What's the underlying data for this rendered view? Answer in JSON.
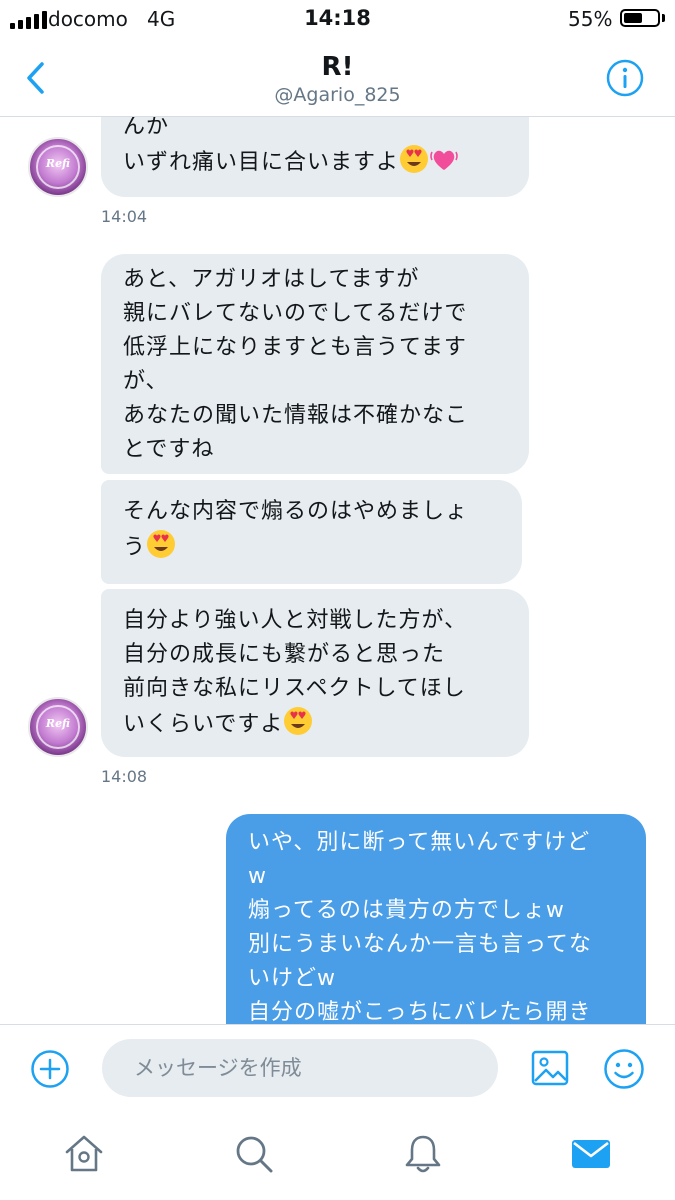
{
  "status_bar": {
    "carrier": "docomo",
    "network": "4G",
    "time": "14:18",
    "battery_percent": "55%",
    "battery_level": 0.55
  },
  "header": {
    "title": "R!",
    "handle": "@Agario_825",
    "back_icon": "chevron-left-icon",
    "info_icon": "info-icon"
  },
  "conversation": {
    "incoming_group_1": {
      "text": "んか\nいずれ痛い目に合いますよ",
      "emojis": [
        "heart-eyes-emoji",
        "growing-heart-emoji"
      ],
      "timestamp": "14:04"
    },
    "incoming_group_2": {
      "messages": [
        {
          "text": "あと、アガリオはしてますが\n親にバレてないのでしてるだけで\n低浮上になりますとも言うてます\nが、\nあなたの聞いた情報は不確かなこ\nとですね"
        },
        {
          "text": "そんな内容で煽るのはやめましょ\nう",
          "emoji": "heart-eyes-emoji"
        },
        {
          "text": "自分より強い人と対戦した方が、\n自分の成長にも繋がると思った\n前向きな私にリスペクトしてほし\nいくらいですよ",
          "emoji": "heart-eyes-emoji"
        }
      ],
      "timestamp": "14:08"
    },
    "outgoing_1": {
      "text": "いや、別に断って無いんですけど\nw\n煽ってるのは貴方の方でしょw\n別にうまいなんか一言も言ってな\nいけどw\n自分の嘘がこっちにバレたら開き"
    },
    "avatar_caption": "Refi"
  },
  "compose": {
    "placeholder": "メッセージを作成",
    "icons": [
      "plus-circle-icon",
      "image-icon",
      "smiley-icon"
    ]
  },
  "tab_bar": {
    "tabs": [
      {
        "icon": "home-icon",
        "active": false
      },
      {
        "icon": "search-icon",
        "active": false
      },
      {
        "icon": "bell-icon",
        "active": false
      },
      {
        "icon": "mail-icon",
        "active": true
      }
    ]
  },
  "colors": {
    "accent": "#1da1f2",
    "outgoing_bubble": "#4a9ee8",
    "incoming_bubble": "#e6ecf0",
    "secondary_text": "#657786",
    "icon_gray": "#657786"
  }
}
